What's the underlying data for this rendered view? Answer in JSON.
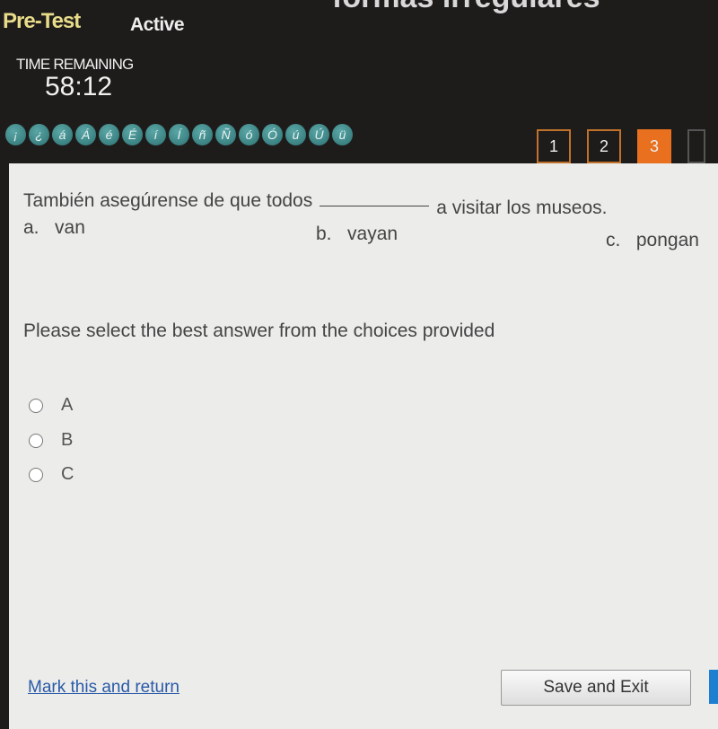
{
  "header": {
    "title_fragment": "formas irregulares",
    "test_type": "Pre-Test",
    "status": "Active",
    "time_label": "TIME REMAINING",
    "time_value": "58:12"
  },
  "special_chars": [
    "¡",
    "¿",
    "á",
    "Á",
    "é",
    "É",
    "í",
    "Í",
    "ñ",
    "Ñ",
    "ó",
    "Ó",
    "ú",
    "Ú",
    "ü"
  ],
  "question_nav": [
    {
      "label": "1",
      "current": false
    },
    {
      "label": "2",
      "current": false
    },
    {
      "label": "3",
      "current": true
    }
  ],
  "question": {
    "before": "También asegúrense de que todos",
    "after": "a visitar los museos.",
    "choices": [
      {
        "letter": "a.",
        "text": "van"
      },
      {
        "letter": "b.",
        "text": "vayan"
      },
      {
        "letter": "c.",
        "text": "pongan"
      }
    ]
  },
  "prompt": "Please select the best answer from the choices provided",
  "options": [
    "A",
    "B",
    "C"
  ],
  "footer": {
    "mark_label": "Mark this and return",
    "save_label": "Save and Exit"
  },
  "colors": {
    "accent": "#e8701e",
    "link": "#2a5aa8",
    "char_button": "#3f8a8b"
  }
}
